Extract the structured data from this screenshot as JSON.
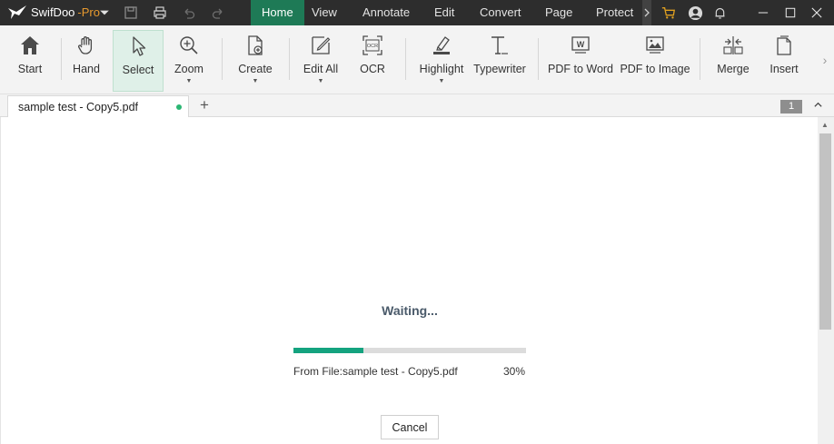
{
  "titlebar": {
    "app_name": "SwifDoo",
    "app_edition": "-Pro",
    "menu_tabs": [
      {
        "label": "Home",
        "active": true
      },
      {
        "label": "View"
      },
      {
        "label": "Annotate"
      },
      {
        "label": "Edit"
      },
      {
        "label": "Convert"
      },
      {
        "label": "Page"
      },
      {
        "label": "Protect"
      }
    ],
    "icons": [
      "app-logo-icon",
      "dropdown-icon",
      "save-icon",
      "print-icon",
      "undo-icon",
      "redo-icon",
      "more-tabs-icon",
      "cart-icon",
      "user-icon",
      "bell-icon",
      "minimize-icon",
      "maximize-icon",
      "close-icon"
    ]
  },
  "ribbon": {
    "buttons": [
      {
        "label": "Start",
        "icon": "home-icon"
      },
      {
        "label": "Hand",
        "icon": "hand-icon"
      },
      {
        "label": "Select",
        "icon": "cursor-icon",
        "active": true
      },
      {
        "label": "Zoom",
        "icon": "zoom-in-icon",
        "dropdown": true
      },
      {
        "label": "Create",
        "icon": "create-file-icon",
        "dropdown": true
      },
      {
        "label": "Edit All",
        "icon": "edit-all-icon",
        "dropdown": true
      },
      {
        "label": "OCR",
        "icon": "ocr-icon"
      },
      {
        "label": "Highlight",
        "icon": "highlight-icon",
        "dropdown": true
      },
      {
        "label": "Typewriter",
        "icon": "typewriter-icon"
      },
      {
        "label": "PDF to Word",
        "icon": "pdf-to-word-icon"
      },
      {
        "label": "PDF to Image",
        "icon": "pdf-to-image-icon"
      },
      {
        "label": "Merge",
        "icon": "merge-icon"
      },
      {
        "label": "Insert",
        "icon": "insert-icon"
      }
    ]
  },
  "tabs": {
    "document": "sample test - Copy5.pdf",
    "page_number": "1"
  },
  "dialog": {
    "status": "Waiting...",
    "progress_value": 30,
    "progress_label": "30%",
    "file_text": "From File:sample test - Copy5.pdf",
    "cancel_label": "Cancel"
  },
  "colors": {
    "titlebar_bg": "#2d2d2d",
    "accent_active_tab": "#1e7a56",
    "progress_fill": "#14a37f",
    "edition_orange": "#e89a2e",
    "select_bg": "#dff0e8"
  }
}
